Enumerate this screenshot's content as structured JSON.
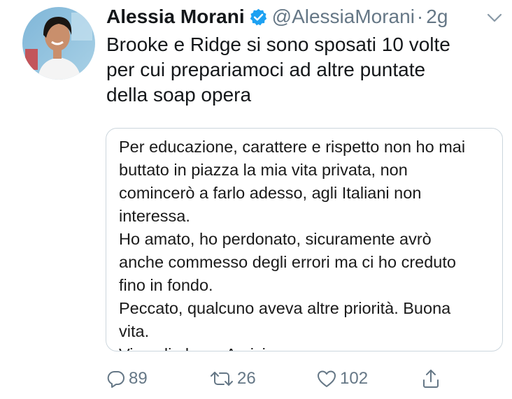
{
  "author": {
    "name": "Alessia Morani",
    "handle": "@AlessiaMorani",
    "separator": "·",
    "time": "2g",
    "verified": true,
    "avatar_icon": "profile-photo"
  },
  "tweet": {
    "lines": [
      "Brooke e Ridge si sono sposati 10 volte",
      "per cui prepariamoci ad altre puntate",
      "della soap opera"
    ]
  },
  "media": {
    "lines": [
      "Per educazione, carattere e rispetto non ho mai",
      "buttato in piazza la mia vita privata, non",
      "comincerò a farlo adesso, agli Italiani non",
      "interessa.",
      "Ho amato, ho perdonato, sicuramente avrò",
      "anche commesso degli errori ma ci ho creduto",
      "fino in fondo.",
      "Peccato, qualcuno aveva altre priorità. Buona",
      "vita.",
      "Vi voglio bene Amici"
    ]
  },
  "actions": {
    "replies": "89",
    "retweets": "26",
    "likes": "102"
  },
  "colors": {
    "verified": "#1da1f2",
    "secondary_text": "#657786",
    "primary_text": "#14171a",
    "border": "#ccd6dd"
  }
}
